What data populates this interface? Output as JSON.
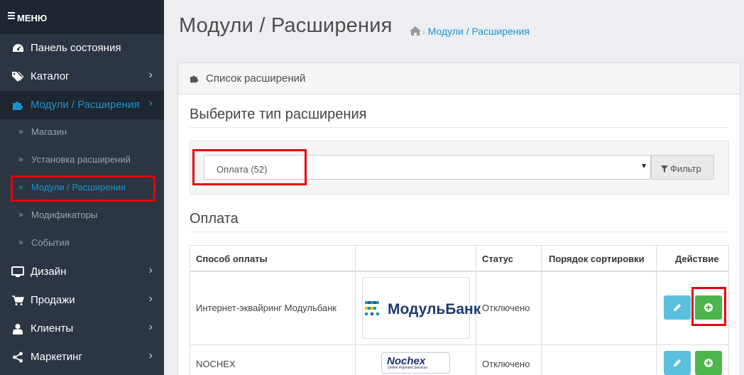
{
  "sidebar": {
    "menu_label": "МЕНЮ",
    "items": [
      {
        "label": "Панель состояния",
        "icon": "dashboard-icon"
      },
      {
        "label": "Каталог",
        "icon": "tags-icon"
      },
      {
        "label": "Модули / Расширения",
        "icon": "puzzle-icon"
      },
      {
        "label": "Дизайн",
        "icon": "monitor-icon"
      },
      {
        "label": "Продажи",
        "icon": "cart-icon"
      },
      {
        "label": "Клиенты",
        "icon": "user-icon"
      },
      {
        "label": "Маркетинг",
        "icon": "share-icon"
      }
    ],
    "subitems": [
      {
        "label": "Магазин"
      },
      {
        "label": "Установка расширений"
      },
      {
        "label": "Модули / Расширения"
      },
      {
        "label": "Модификаторы"
      },
      {
        "label": "События"
      }
    ]
  },
  "header": {
    "title": "Модули / Расширения",
    "breadcrumb": "Модули / Расширения"
  },
  "panel": {
    "title": "Список расширений",
    "select_heading": "Выберите тип расширения",
    "select_value": "Оплата (52)",
    "filter_label": "Фильтр",
    "section_heading": "Оплата"
  },
  "table": {
    "headers": [
      "Способ оплаты",
      "",
      "Статус",
      "Порядок сортировки",
      "Действие"
    ],
    "rows": [
      {
        "name": "Интернет-эквайринг Модульбанк",
        "logo_text": "МодульБанк",
        "status": "Отключено",
        "sort": ""
      },
      {
        "name": "NOCHEX",
        "logo_text": "Nochex",
        "logo_sub": "Online Payment Services",
        "status": "Отключено",
        "sort": ""
      }
    ]
  },
  "colors": {
    "sidebar_bg": "#2b3642",
    "accent": "#1e91cf",
    "edit_button": "#5bc0de",
    "install_button": "#4cb64c",
    "highlight": "#e8000b"
  }
}
